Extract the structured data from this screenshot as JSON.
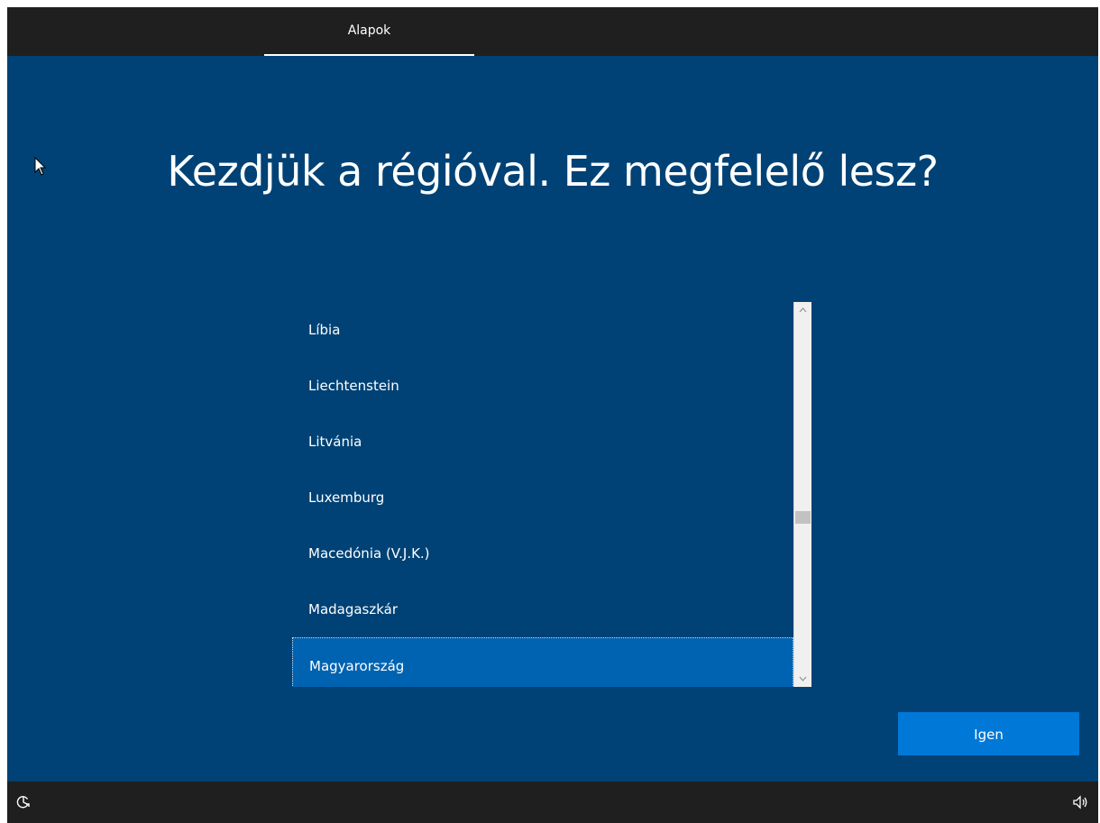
{
  "header": {
    "tab_label": "Alapok"
  },
  "main": {
    "title": "Kezdjük a régióval. Ez megfelelő lesz?"
  },
  "region_list": {
    "items": [
      {
        "label": "Líbia"
      },
      {
        "label": "Liechtenstein"
      },
      {
        "label": "Litvánia"
      },
      {
        "label": "Luxemburg"
      },
      {
        "label": "Macedónia (V.J.K.)"
      },
      {
        "label": "Madagaszkár"
      },
      {
        "label": "Magyarország"
      }
    ],
    "selected_index": 6
  },
  "actions": {
    "confirm_label": "Igen"
  },
  "icons": {
    "cursor": "mouse-pointer-icon",
    "ease_of_access": "ease-of-access-icon",
    "volume": "speaker-icon",
    "scroll_up": "chevron-up-icon",
    "scroll_down": "chevron-down-icon"
  },
  "colors": {
    "background": "#004275",
    "bar": "#1f1f1f",
    "selection": "#0063b1",
    "button": "#0078d7"
  }
}
